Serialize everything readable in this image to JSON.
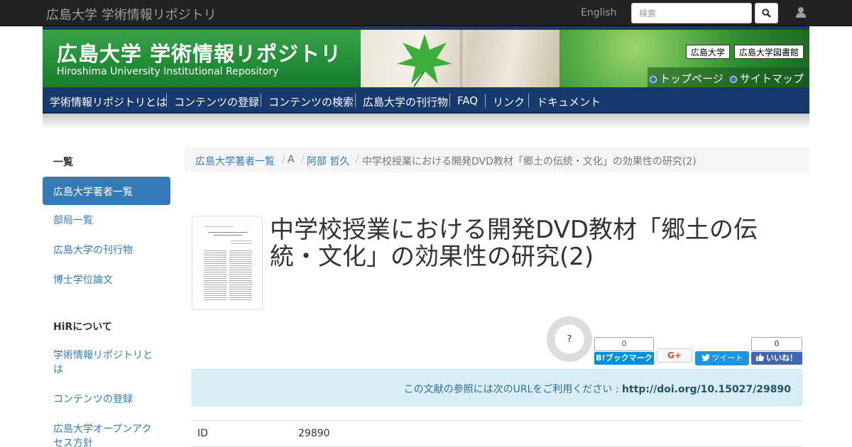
{
  "topbar": {
    "brand": "広島大学 学術情報リポジトリ",
    "language_link": "English",
    "search_placeholder": "検索"
  },
  "banner": {
    "title_jp": "広島大学 学術情報リポジトリ",
    "title_en": "Hiroshima University Institutional Repository",
    "link_university": "広島大学",
    "link_library": "広島大学図書館",
    "link_top": "トップページ",
    "link_sitemap": "サイトマップ"
  },
  "mainnav": {
    "items": [
      "学術情報リポジトリとは",
      "コンテンツの登録",
      "コンテンツの検索",
      "広島大学の刊行物",
      "FAQ",
      "リンク",
      "ドキュメント"
    ]
  },
  "sidebar": {
    "heading1": "一覧",
    "items1": [
      "広島大学著者一覧",
      "部局一覧",
      "広島大学の刊行物",
      "博士学位論文"
    ],
    "heading2": "HiRについて",
    "items2": [
      "学術情報リポジトリとは",
      "コンテンツの登録",
      "広島大学オープンアクセス方針"
    ]
  },
  "breadcrumb": {
    "items": [
      "広島大学著者一覧",
      "A",
      "阿部 哲久"
    ],
    "current": "中学校授業における開発DVD教材「郷土の伝統・文化」の効果性の研究(2)"
  },
  "article": {
    "title": "中学校授業における開発DVD教材「郷土の伝統・文化」の効果性の研究(2)"
  },
  "social": {
    "gauge_label": "?",
    "hatena_count": "0",
    "hatena_label": "B!ブックマーク",
    "gplus_label": "G+",
    "tweet_label": "ツイート",
    "fb_count": "0",
    "fb_label": "いいね！"
  },
  "alert": {
    "text": "この文献の参照には次のURLをご利用ください : ",
    "url": "http://doi.org/10.15027/29890"
  },
  "table": {
    "rows": [
      {
        "key": "ID",
        "value": "29890"
      }
    ]
  }
}
